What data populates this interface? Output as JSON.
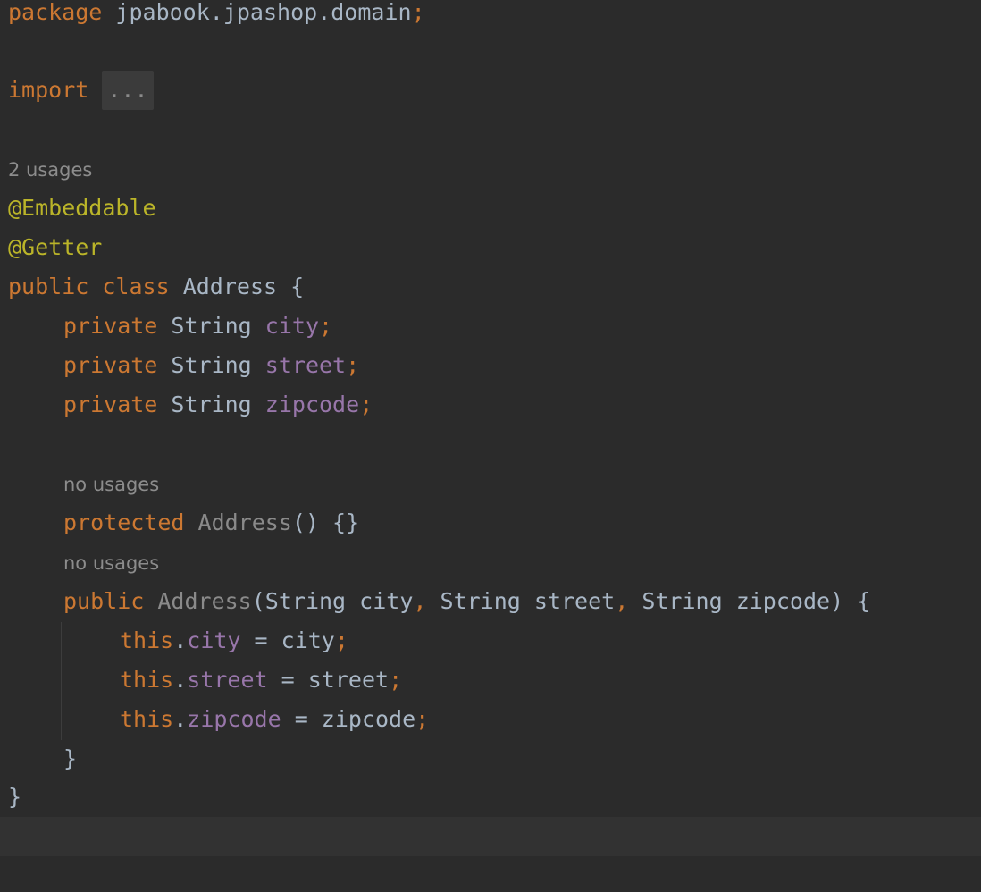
{
  "editor": {
    "package_kw": "package",
    "package_name": "jpabook.jpashop.domain",
    "semicolon": ";",
    "import_kw": "import",
    "import_fold": "...",
    "class_usages": "2 usages",
    "annotation_embeddable": "@Embeddable",
    "annotation_getter": "@Getter",
    "public_kw": "public",
    "class_kw": "class",
    "class_name": "Address",
    "open_brace": "{",
    "close_brace": "}",
    "private_kw": "private",
    "string_type": "String",
    "field_city": "city",
    "field_street": "street",
    "field_zipcode": "zipcode",
    "ctor1_usages": "no usages",
    "protected_kw": "protected",
    "ctor1_name": "Address",
    "ctor1_rest": "() {}",
    "ctor2_usages": "no usages",
    "ctor2_name": "Address",
    "ctor2_params_open": "(",
    "param_city": "city",
    "param_street": "street",
    "param_zipcode": "zipcode",
    "comma": ",",
    "ctor2_params_close": ") {",
    "this_kw": "this",
    "dot": ".",
    "assign": " = "
  },
  "colors": {
    "background": "#2b2b2b",
    "keyword": "#cc7832",
    "annotation": "#bbb529",
    "field": "#9876aa",
    "text": "#a9b7c6",
    "hint": "#8c8c8c"
  }
}
